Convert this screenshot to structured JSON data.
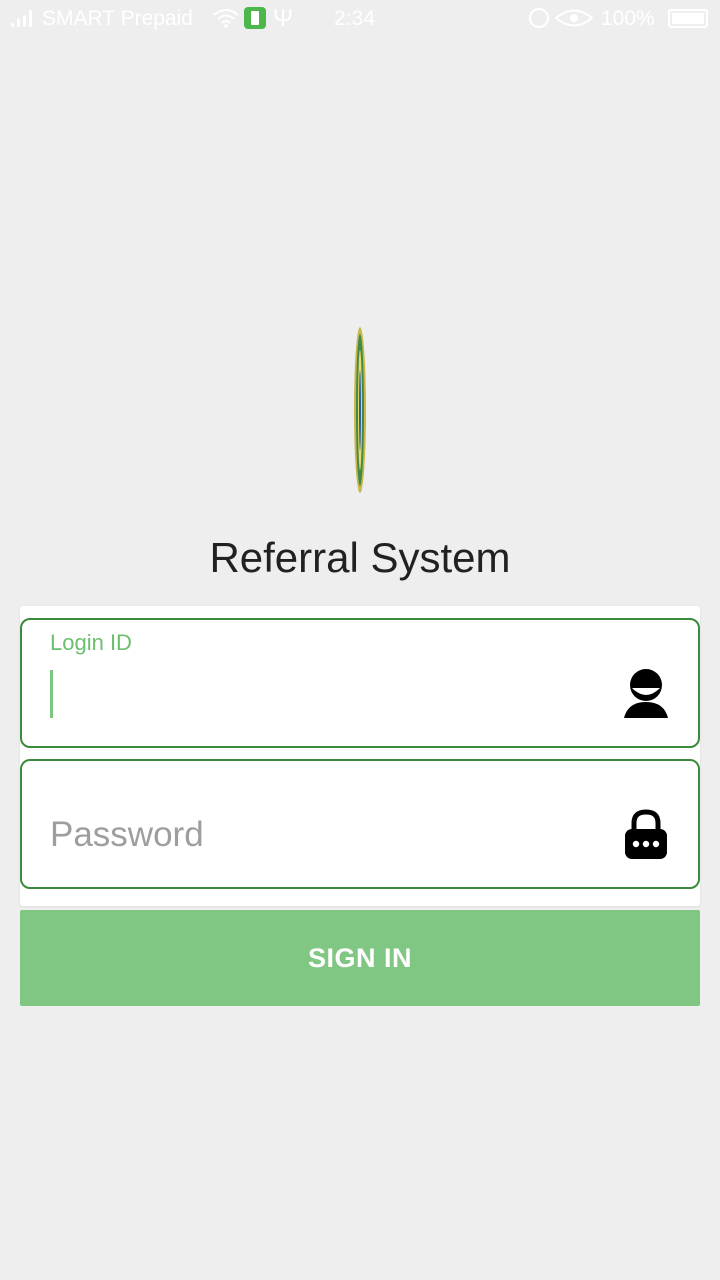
{
  "status_bar": {
    "carrier": "SMART Prepaid",
    "time": "2:34",
    "battery_percent": "100%",
    "icons": [
      "signal-icon",
      "wifi-icon",
      "battery-charging-icon",
      "usb-icon",
      "alarm-icon",
      "eye-icon",
      "battery-icon"
    ]
  },
  "app": {
    "title": "Referral System"
  },
  "login_form": {
    "login_id": {
      "label": "Login ID",
      "value": "",
      "icon": "user-icon"
    },
    "password": {
      "placeholder": "Password",
      "value": "",
      "icon": "lock-icon"
    },
    "sign_in_label": "SIGN IN"
  },
  "colors": {
    "background": "#eeeeee",
    "field_border": "#3a8b3c",
    "label_green": "#6cbf6e",
    "button": "#81c784"
  }
}
